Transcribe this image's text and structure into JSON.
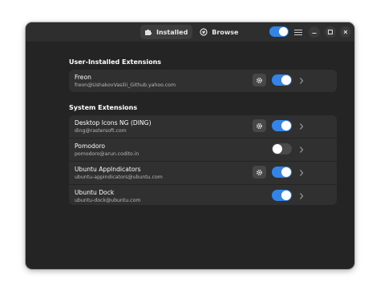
{
  "header": {
    "tabs": [
      {
        "label": "Installed",
        "icon": "puzzle-icon",
        "active": true
      },
      {
        "label": "Browse",
        "icon": "globe-icon",
        "active": false
      }
    ],
    "extensions_enabled": true
  },
  "user_section": {
    "title": "User-Installed Extensions",
    "items": [
      {
        "name": "Freon",
        "uuid": "freon@UshakovVasilii_Github.yahoo.com",
        "has_settings": true,
        "enabled": true
      }
    ]
  },
  "system_section": {
    "title": "System Extensions",
    "items": [
      {
        "name": "Desktop Icons NG (DING)",
        "uuid": "ding@rastersoft.com",
        "has_settings": true,
        "enabled": true
      },
      {
        "name": "Pomodoro",
        "uuid": "pomodoro@arun.codito.in",
        "has_settings": false,
        "enabled": false
      },
      {
        "name": "Ubuntu AppIndicators",
        "uuid": "ubuntu-appindicators@ubuntu.com",
        "has_settings": true,
        "enabled": true
      },
      {
        "name": "Ubuntu Dock",
        "uuid": "ubuntu-dock@ubuntu.com",
        "has_settings": false,
        "enabled": true
      }
    ]
  },
  "colors": {
    "accent": "#3584e4",
    "window_bg": "#242424",
    "card_bg": "#303030"
  }
}
